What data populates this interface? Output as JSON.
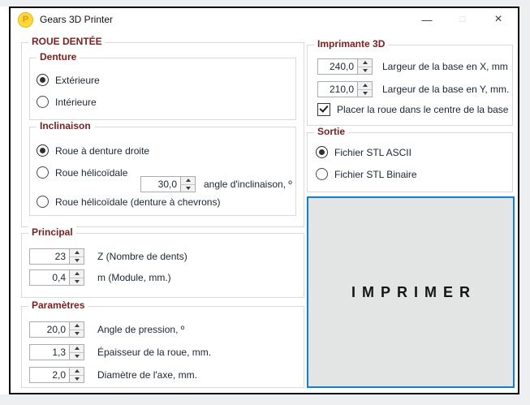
{
  "window": {
    "title": "Gears 3D Printer",
    "icon_letter": "P",
    "controls": {
      "minimize": "—",
      "maximize": "□",
      "close": "×"
    }
  },
  "colors": {
    "accent_blue": "#0f7fd8",
    "group_title_maroon": "#7f1d1d",
    "titlebar_icon_yellow": "#ffd83a"
  },
  "roue_dentee": {
    "title": "ROUE DENTÉE",
    "denture": {
      "title": "Denture",
      "options": [
        {
          "label": "Extérieure",
          "selected": true
        },
        {
          "label": "Intérieure",
          "selected": false
        }
      ]
    },
    "inclinaison": {
      "title": "Inclinaison",
      "options": [
        {
          "label": "Roue à denture droite",
          "selected": true
        },
        {
          "label": "Roue hélicoïdale",
          "selected": false
        },
        {
          "label": "Roue hélicoïdale (denture à chevrons)",
          "selected": false
        }
      ],
      "angle": {
        "value": "30,0",
        "label": "angle d'inclinaison, º"
      }
    }
  },
  "principal": {
    "title": "Principal",
    "fields": [
      {
        "value": "23",
        "label": "Z (Nombre de dents)"
      },
      {
        "value": "0,4",
        "label": "m (Module, mm.)"
      }
    ]
  },
  "parametres": {
    "title": "Paramètres",
    "fields": [
      {
        "value": "20,0",
        "label": "Angle de pression, º"
      },
      {
        "value": "1,3",
        "label": "Épaisseur de la roue, mm."
      },
      {
        "value": "2,0",
        "label": "Diamètre de l'axe, mm."
      }
    ]
  },
  "imprimante": {
    "title": "Imprimante 3D",
    "fields": [
      {
        "value": "240,0",
        "label": "Largeur de la base en X, mm"
      },
      {
        "value": "210,0",
        "label": "Largeur de la base en Y, mm."
      }
    ],
    "checkbox": {
      "label": "Placer la roue dans le centre de la base",
      "checked": true
    }
  },
  "sortie": {
    "title": "Sortie",
    "options": [
      {
        "label": "Fichier STL ASCII",
        "selected": true
      },
      {
        "label": "Fichier STL Binaire",
        "selected": false
      }
    ]
  },
  "print_button": {
    "label": "IMPRIMER"
  }
}
